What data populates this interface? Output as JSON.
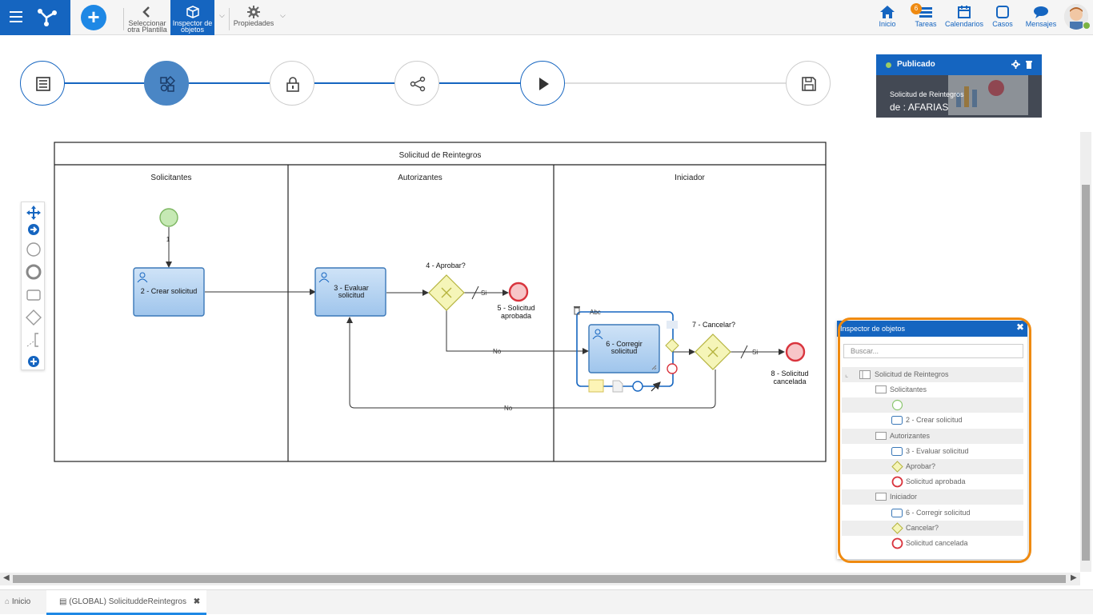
{
  "toolbar": {
    "select_template_line1": "Seleccionar",
    "select_template_line2": "otra Plantilla",
    "inspector_line1": "Inspector de",
    "inspector_line2": "objetos",
    "properties": "Propiedades"
  },
  "nav": {
    "home": "Inicio",
    "tasks": "Tareas",
    "tasks_badge": "6",
    "calendars": "Calendarios",
    "cases": "Casos",
    "messages": "Mensajes"
  },
  "card": {
    "status": "Publicado",
    "title": "Solicitud de Reintegros",
    "author": "de : AFARIAS"
  },
  "diagram": {
    "pool_title": "Solicitud de  Reintegros",
    "lane1": "Solicitantes",
    "lane2": "Autorizantes",
    "lane3": "Iniciador",
    "flow_start_label": "1",
    "task2": "2 - Crear solicitud",
    "task3_a": "3 - Evaluar",
    "task3_b": "solicitud",
    "gw4": "4 - Aprobar?",
    "yes": "Si",
    "end5_a": "5 - Solicitud",
    "end5_b": "aprobada",
    "no": "No",
    "task6_a": "6 - Corregir",
    "task6_b": "solicitud",
    "gw7": "7 - Cancelar?",
    "end8_a": "8 - Solicitud",
    "end8_b": "cancelada",
    "abc": "Abc"
  },
  "inspector": {
    "title": "Inspector de objetos",
    "search_placeholder": "Buscar...",
    "items": [
      "Solicitud de Reintegros",
      "Solicitantes",
      "",
      "2 - Crear solicitud",
      "Autorizantes",
      "3 - Evaluar solicitud",
      "Aprobar?",
      "Solicitud aprobada",
      "Iniciador",
      "6 - Corregir solicitud",
      "Cancelar?",
      "Solicitud cancelada"
    ]
  },
  "tabs": {
    "home": "Inicio",
    "current": "(GLOBAL) SolicituddeReintegros"
  },
  "colors": {
    "primary": "#1565c0",
    "accent": "#ef8a10",
    "task_fill": "#b3d4f2",
    "gateway_fill": "#f5f5b8",
    "start": "#c6e9b4",
    "end": "#f7c6c8"
  }
}
